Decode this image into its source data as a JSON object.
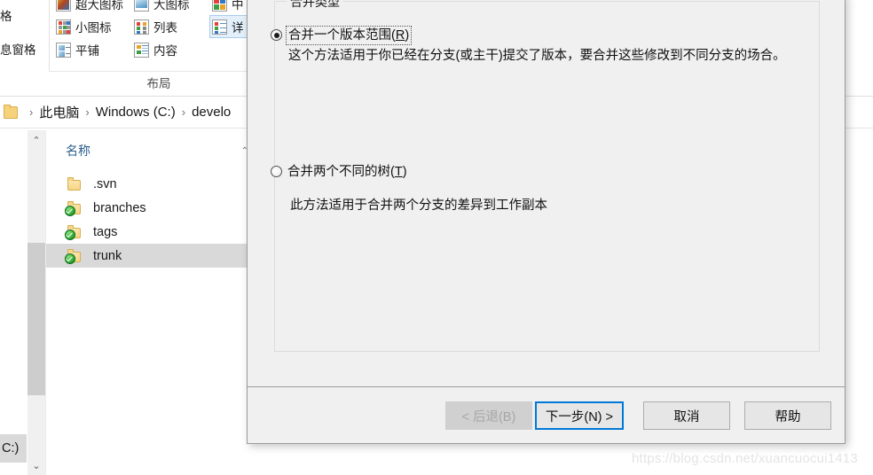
{
  "explorer": {
    "ribbon": {
      "left_labels": [
        "格",
        "息窗格"
      ],
      "group_label": "布局",
      "view_options": [
        {
          "label": "超大图标",
          "icon": "extra-large-icons-icon",
          "selected": false
        },
        {
          "label": "大图标",
          "icon": "large-icons-icon",
          "selected": false
        },
        {
          "label": "中",
          "icon": "medium-icons-icon",
          "selected": false
        },
        {
          "label": "小图标",
          "icon": "small-icons-icon",
          "selected": false
        },
        {
          "label": "列表",
          "icon": "list-view-icon",
          "selected": false
        },
        {
          "label": "详",
          "icon": "details-view-icon",
          "selected": true
        },
        {
          "label": "平铺",
          "icon": "tiles-view-icon",
          "selected": false
        },
        {
          "label": "内容",
          "icon": "content-view-icon",
          "selected": false
        }
      ]
    },
    "breadcrumb": {
      "separator": "›",
      "items": [
        "此电脑",
        "Windows (C:)",
        "develo"
      ]
    },
    "file_list": {
      "column_header": "名称",
      "sort_caret": "⌃",
      "rows": [
        {
          "name": ".svn",
          "icon": "folder-icon",
          "svn_status": false,
          "selected": false
        },
        {
          "name": "branches",
          "icon": "folder-icon",
          "svn_status": true,
          "selected": false
        },
        {
          "name": "tags",
          "icon": "folder-icon",
          "svn_status": true,
          "selected": false
        },
        {
          "name": "trunk",
          "icon": "folder-icon",
          "svn_status": true,
          "selected": true
        }
      ]
    },
    "bottom_fragment": "C:)",
    "scrollbar": {
      "up_arrow": "⌃",
      "down_arrow": "⌄"
    }
  },
  "dialog": {
    "groupbox_title": "合并类型",
    "options": [
      {
        "label_prefix": "合并一个版本范围(",
        "mnemonic": "R",
        "label_suffix": ")",
        "checked": true,
        "focused": true,
        "description": "这个方法适用于你已经在分支(或主干)提交了版本，要合并这些修改到不同分支的场合。"
      },
      {
        "label_prefix": "合并两个不同的树(",
        "mnemonic": "T",
        "label_suffix": ")",
        "checked": false,
        "focused": false,
        "description": "此方法适用于合并两个分支的差异到工作副本"
      }
    ],
    "buttons": {
      "back": "< 后退(B)",
      "next": "下一步(N) >",
      "cancel": "取消",
      "help": "帮助"
    }
  },
  "watermark": "https://blog.csdn.net/xuancuocui1413",
  "colors": {
    "dialog_bg": "#f0f0f0",
    "accent_focus": "#0078d7",
    "selection": "#d9d9d9",
    "ribbon_selection": "#e3f0fb",
    "breadcrumb_text": "#161616",
    "column_header": "#2b5f8e",
    "svn_green": "#36b23a"
  }
}
